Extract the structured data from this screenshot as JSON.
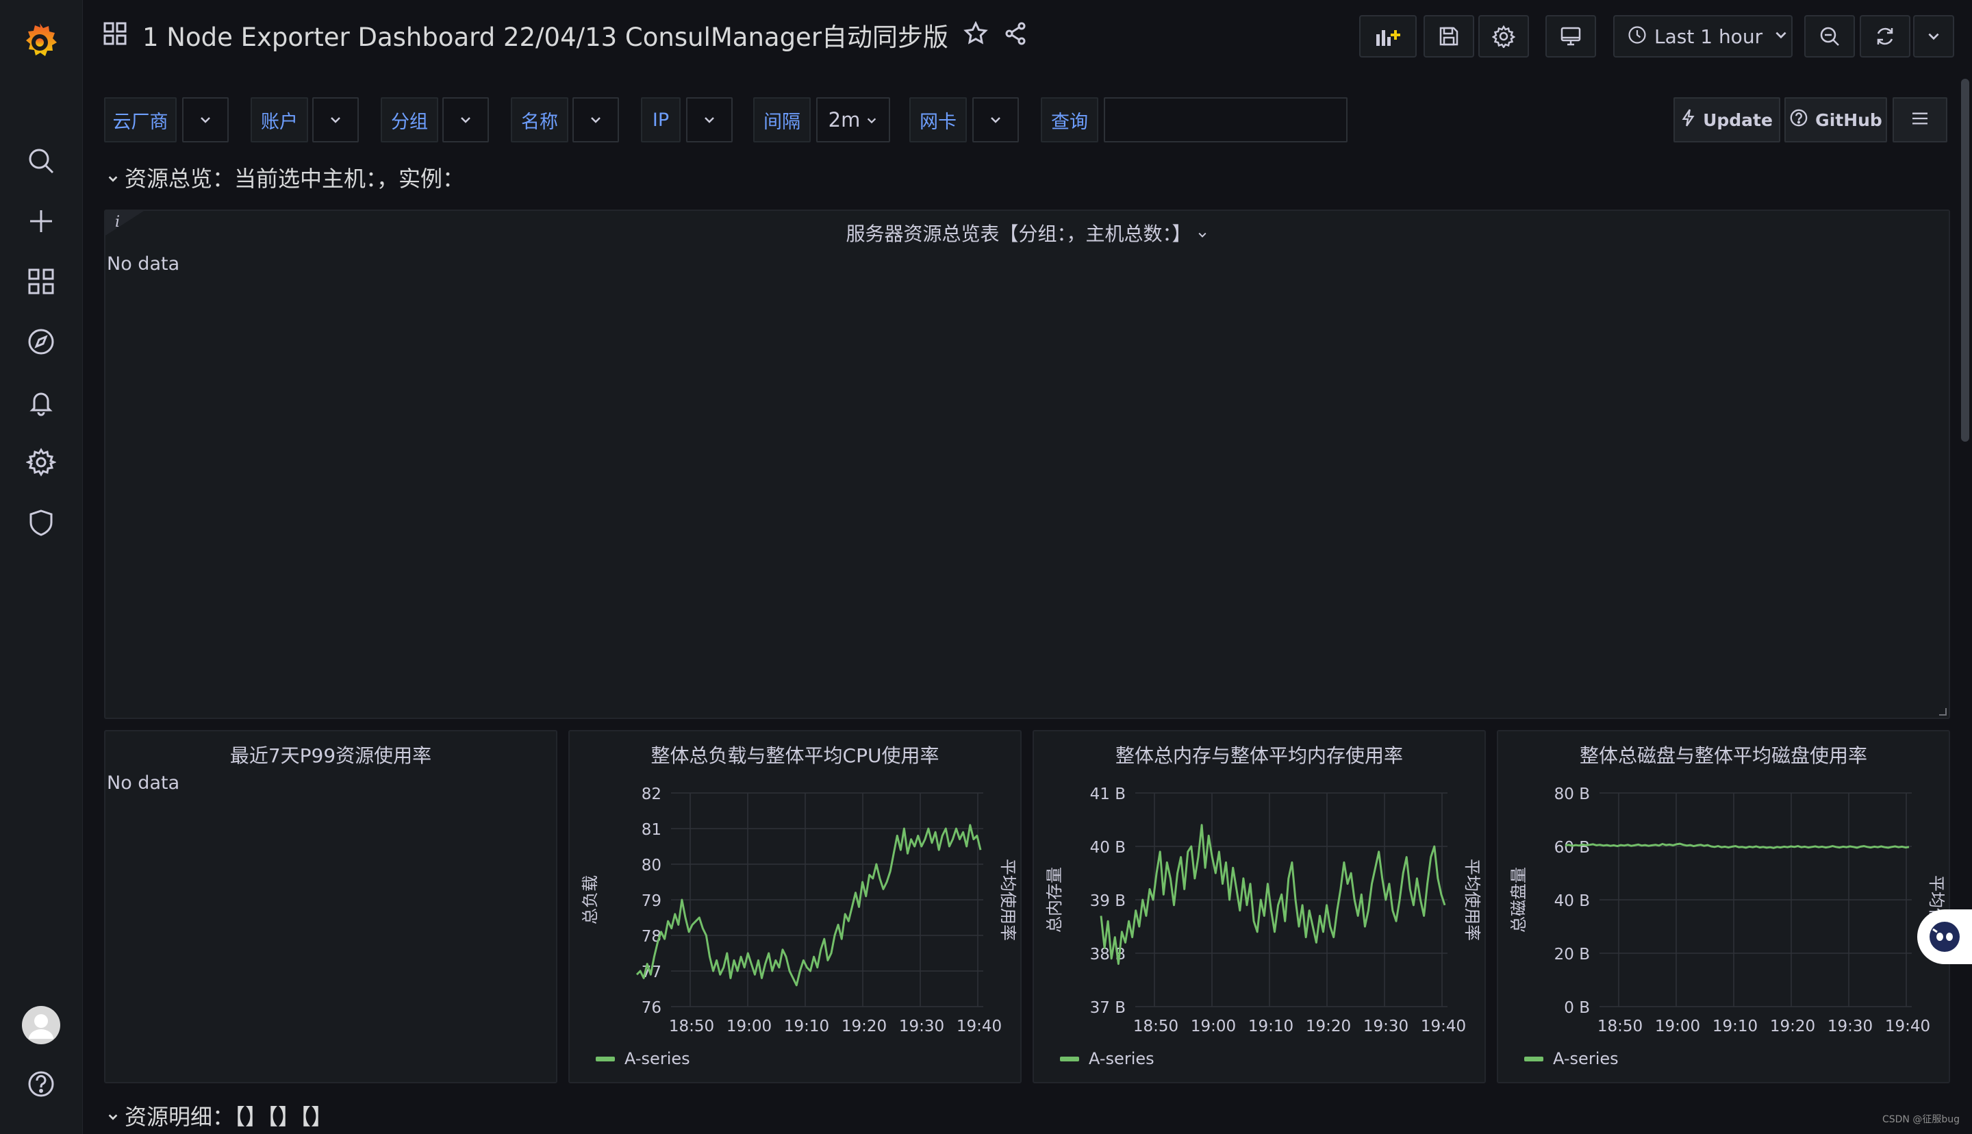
{
  "header": {
    "title": "1 Node Exporter Dashboard 22/04/13 ConsulManager自动同步版",
    "time_range": "Last 1 hour"
  },
  "variables": [
    {
      "label": "云厂商",
      "value": ""
    },
    {
      "label": "账户",
      "value": ""
    },
    {
      "label": "分组",
      "value": ""
    },
    {
      "label": "名称",
      "value": ""
    },
    {
      "label": "IP",
      "value": ""
    },
    {
      "label": "间隔",
      "value": "2m"
    },
    {
      "label": "网卡",
      "value": ""
    },
    {
      "label": "查询",
      "value": ""
    }
  ],
  "links": {
    "update": "Update",
    "github": "GitHub"
  },
  "rows": {
    "overview": "资源总览：当前选中主机：，实例：",
    "details": "资源明细：【】【】【】"
  },
  "panels": {
    "summary": {
      "title": "服务器资源总览表【分组：，主机总数：】",
      "nodata": "No data",
      "info": "i"
    },
    "p99": {
      "title": "最近7天P99资源使用率",
      "nodata": "No data"
    }
  },
  "chart_data": [
    {
      "type": "line",
      "title": "整体总负载与整体平均CPU使用率",
      "ylabel": "总负载",
      "ylabel_right": "平均使用率",
      "xticks": [
        "18:50",
        "19:00",
        "19:10",
        "19:20",
        "19:30",
        "19:40"
      ],
      "yticks": [
        "82",
        "81",
        "80",
        "79",
        "78",
        "77",
        "76"
      ],
      "ylim": [
        76,
        82
      ],
      "grid": true,
      "legend_position": "bottom-left",
      "series": [
        {
          "name": "A-series",
          "color": "#73bf69",
          "values": [
            76.9,
            77.0,
            76.8,
            77.2,
            76.9,
            77.4,
            77.8,
            78.1,
            77.9,
            78.4,
            78.2,
            78.6,
            78.3,
            79.0,
            78.5,
            78.1,
            78.3,
            78.4,
            78.5,
            78.2,
            78.0,
            77.4,
            77.0,
            77.3,
            76.9,
            77.1,
            77.5,
            76.8,
            77.3,
            77.0,
            77.4,
            77.1,
            77.5,
            77.2,
            76.9,
            77.3,
            76.8,
            77.2,
            77.5,
            77.0,
            77.3,
            77.1,
            77.6,
            77.4,
            77.0,
            76.8,
            76.6,
            77.0,
            77.3,
            77.1,
            77.0,
            77.4,
            77.1,
            77.6,
            77.9,
            77.3,
            77.5,
            78.0,
            78.3,
            77.9,
            78.6,
            78.4,
            78.8,
            79.2,
            78.8,
            79.5,
            79.1,
            79.7,
            79.6,
            80.0,
            79.6,
            79.3,
            79.5,
            79.8,
            80.3,
            80.8,
            80.4,
            81.0,
            80.3,
            80.7,
            80.5,
            80.8,
            80.5,
            80.7,
            81.0,
            80.6,
            80.9,
            80.4,
            80.8,
            81.0,
            80.5,
            80.7,
            81.0,
            80.7,
            80.9,
            80.5,
            81.1,
            80.7,
            80.8,
            80.4
          ]
        }
      ]
    },
    {
      "type": "line",
      "title": "整体总内存与整体平均内存使用率",
      "ylabel": "总内存量",
      "ylabel_right": "平均使用率",
      "xticks": [
        "18:50",
        "19:00",
        "19:10",
        "19:20",
        "19:30",
        "19:40"
      ],
      "yticks": [
        "41 B",
        "40 B",
        "39 B",
        "38 B",
        "37 B"
      ],
      "ylim": [
        37,
        41
      ],
      "grid": true,
      "legend_position": "bottom-left",
      "series": [
        {
          "name": "A-series",
          "color": "#73bf69",
          "values": [
            38.7,
            38.1,
            38.6,
            37.9,
            38.3,
            37.8,
            38.4,
            38.2,
            38.6,
            38.3,
            38.8,
            38.5,
            39.0,
            38.7,
            39.2,
            39.0,
            39.5,
            39.9,
            39.1,
            39.7,
            39.4,
            38.9,
            39.5,
            39.8,
            39.2,
            39.9,
            40.0,
            39.4,
            39.8,
            40.4,
            39.6,
            40.2,
            39.8,
            39.5,
            39.9,
            39.3,
            39.7,
            39.0,
            39.6,
            39.2,
            38.8,
            39.4,
            38.9,
            39.3,
            38.6,
            38.4,
            39.0,
            38.7,
            39.3,
            38.8,
            38.4,
            38.9,
            39.1,
            38.6,
            39.4,
            39.7,
            39.0,
            38.5,
            38.9,
            38.3,
            38.8,
            38.5,
            38.2,
            38.7,
            38.4,
            38.9,
            38.5,
            38.3,
            38.8,
            39.2,
            39.7,
            39.3,
            39.5,
            39.0,
            38.7,
            39.1,
            38.5,
            38.8,
            39.3,
            39.6,
            39.9,
            39.4,
            39.0,
            39.3,
            38.8,
            38.6,
            39.0,
            39.5,
            39.8,
            39.2,
            38.9,
            39.4,
            39.0,
            38.7,
            39.3,
            39.8,
            40.0,
            39.4,
            39.1,
            38.9
          ]
        }
      ]
    },
    {
      "type": "line",
      "title": "整体总磁盘与整体平均磁盘使用率",
      "ylabel": "总磁盘量",
      "ylabel_right": "平均使",
      "xticks": [
        "18:50",
        "19:00",
        "19:10",
        "19:20",
        "19:30",
        "19:40"
      ],
      "yticks": [
        "80 B",
        "60 B",
        "40 B",
        "20 B",
        "0 B"
      ],
      "ylim": [
        0,
        80
      ],
      "grid": true,
      "legend_position": "bottom-left",
      "series": [
        {
          "name": "A-series",
          "color": "#73bf69",
          "values": [
            60.3,
            60.6,
            60.2,
            60.5,
            60.3,
            60.7,
            60.4,
            60.6,
            60.8,
            60.4,
            60.6,
            60.3,
            60.5,
            60.2,
            60.4,
            60.1,
            60.5,
            60.3,
            60.6,
            60.2,
            60.4,
            60.7,
            60.3,
            60.5,
            60.2,
            60.4,
            60.6,
            60.3,
            60.9,
            60.5,
            60.7,
            60.4,
            60.8,
            61.0,
            60.6,
            60.3,
            60.5,
            60.1,
            60.4,
            60.6,
            60.2,
            60.5,
            60.0,
            59.8,
            60.1,
            59.7,
            59.9,
            59.6,
            59.9,
            60.1,
            59.7,
            59.8,
            59.5,
            59.9,
            59.7,
            60.0,
            59.6,
            59.8,
            59.5,
            59.7,
            59.4,
            59.8,
            59.6,
            59.9,
            59.7,
            60.0,
            59.8,
            60.1,
            59.7,
            59.9,
            59.6,
            59.8,
            60.0,
            59.7,
            59.9,
            59.6,
            59.8,
            60.1,
            59.8,
            59.6,
            59.9,
            59.7,
            60.0,
            59.8,
            59.5,
            59.9,
            60.1,
            59.8,
            59.6,
            59.9,
            59.7,
            60.0,
            59.7,
            59.5,
            59.8,
            60.0,
            59.7,
            59.9,
            59.6,
            59.8
          ]
        }
      ]
    }
  ]
}
